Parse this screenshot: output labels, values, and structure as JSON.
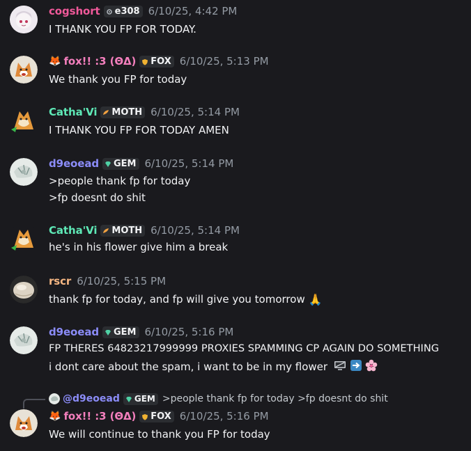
{
  "colors": {
    "background": "#1a1a1e",
    "cogshort": "#f0599a",
    "fox": "#f47fbd",
    "catha": "#5ee8b6",
    "d9": "#8b8cf8",
    "rscr": "#f6b783"
  },
  "messages": [
    {
      "name": "cogshort",
      "tag": "e308",
      "tag_icon": "gear-icon",
      "time": "6/10/25, 4:42 PM",
      "lines": [
        "I THANK YOU FP FOR TODAY."
      ]
    },
    {
      "name": "fox!! :3  (ΘΔ)",
      "prefix_emoji": "🦊",
      "tag": "FOX",
      "tag_icon": "shield-icon",
      "time": "6/10/25, 5:13 PM",
      "lines": [
        "We thank you FP for today"
      ]
    },
    {
      "name": "Catha'Vi",
      "tag": "MOTH",
      "tag_icon": "wing-icon",
      "time": "6/10/25, 5:14 PM",
      "lines": [
        "I THANK YOU FP FOR TODAY AMEN"
      ]
    },
    {
      "name": "d9eoead",
      "tag": "GEM",
      "tag_icon": "gem-icon",
      "time": "6/10/25, 5:14 PM",
      "lines": [
        ">people thank fp for today",
        ">fp doesnt do shit"
      ]
    },
    {
      "name": "Catha'Vi",
      "tag": "MOTH",
      "tag_icon": "wing-icon",
      "time": "6/10/25, 5:14 PM",
      "lines": [
        "he's in his flower give him a break"
      ]
    },
    {
      "name": "rscr",
      "time": "6/10/25, 5:15 PM",
      "lines": [
        "thank fp for today, and fp will give you tomorrow"
      ],
      "trailing_emoji": "🙏"
    },
    {
      "name": "d9eoead",
      "tag": "GEM",
      "tag_icon": "gem-icon",
      "time": "6/10/25, 5:16 PM",
      "lines": [
        "FP THERES 64823217999999 PROXIES SPAMMING CP AGAIN DO SOMETHING",
        "i dont care about the spam, i want to be in my flower"
      ],
      "trailing_emojis": [
        "computer-icon",
        "right-arrow-icon",
        "cherry-blossom-icon"
      ]
    },
    {
      "name": "fox!! :3  (ΘΔ)",
      "prefix_emoji": "🦊",
      "tag": "FOX",
      "tag_icon": "shield-icon",
      "time": "6/10/25, 5:16 PM",
      "lines": [
        "We will continue to thank you FP for today"
      ],
      "reply": {
        "mention": "@d9eoead",
        "tag": "GEM",
        "text": ">people thank fp for today >fp doesnt do shit"
      }
    }
  ]
}
